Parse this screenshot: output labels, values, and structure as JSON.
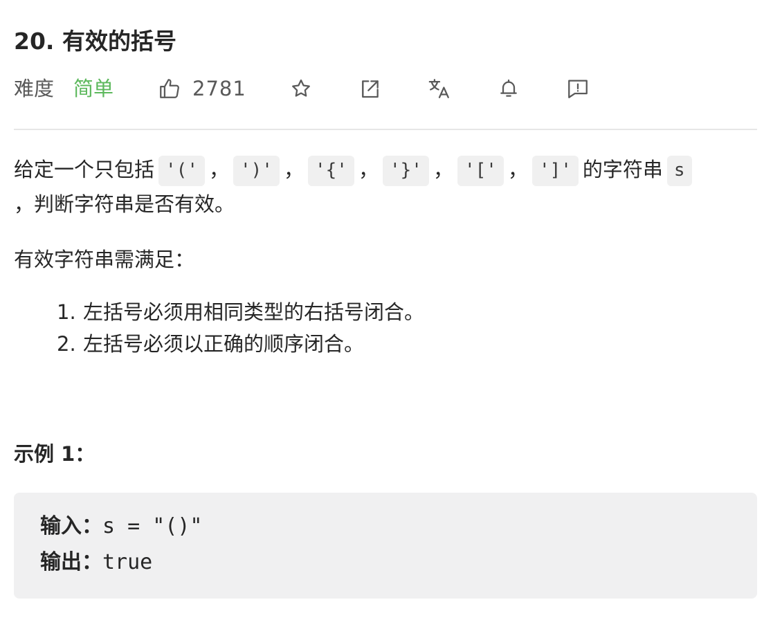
{
  "problem": {
    "title": "20. 有效的括号",
    "difficulty_label": "难度",
    "difficulty_value": "简单",
    "like_count": "2781"
  },
  "toolbar": {
    "icons": [
      "thumbs-up-icon",
      "star-icon",
      "share-icon",
      "translate-icon",
      "bell-icon",
      "feedback-icon"
    ]
  },
  "description": {
    "intro_prefix": "给定一个只包括",
    "tokens": [
      "'('",
      "')'",
      "'{'",
      "'}'",
      "'['",
      "']'"
    ],
    "separator": "，",
    "intro_suffix": "的字符串",
    "var_name": "s",
    "intro_line2": "，判断字符串是否有效。",
    "rules_heading": "有效字符串需满足：",
    "rules": [
      {
        "num": "1.",
        "text": "左括号必须用相同类型的右括号闭合。"
      },
      {
        "num": "2.",
        "text": "左括号必须以正确的顺序闭合。"
      }
    ]
  },
  "example": {
    "title": "示例 1：",
    "input_label": "输入：",
    "input_value": "s = \"()\"",
    "output_label": "输出：",
    "output_value": "true"
  },
  "colors": {
    "easy": "#5cb85c",
    "text": "#262626",
    "muted": "#595959",
    "code_bg": "#f0f0f0"
  }
}
